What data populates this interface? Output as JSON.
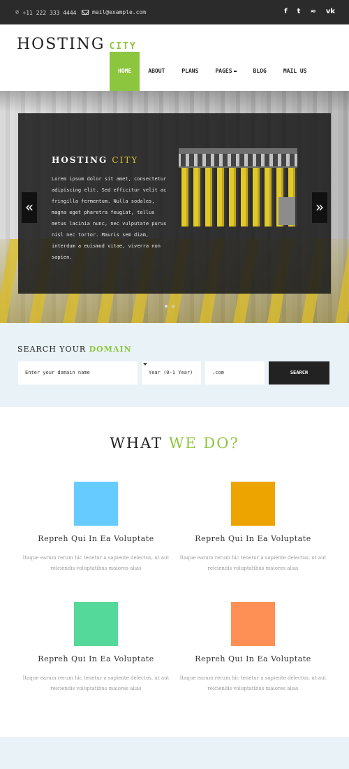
{
  "topbar": {
    "phone": "+11 222 333 4444",
    "email": "mail@example.com",
    "social_icons": [
      "facebook-icon",
      "twitter-icon",
      "rss-icon",
      "vk-icon"
    ],
    "social_glyphs": [
      "f",
      "t",
      "≈",
      "vk"
    ]
  },
  "header": {
    "logo_main": "HOSTING",
    "logo_accent": "CITY",
    "nav": [
      "HOME",
      "ABOUT",
      "PLANS",
      "PAGES",
      "BLOG",
      "MAIL US"
    ],
    "active_nav": "HOME"
  },
  "hero": {
    "title_main": "HOSTING",
    "title_accent": "CITY",
    "text": "Lorem ipsum dolor sit amet, consectetur adipiscing elit. Sed efficitur velit ac fringilla fermentum. Nulla sodales, magna eget pharetra feugiat, tellus metus lacinia nunc, nec vulputate purus nisl nec tortor. Mauris sem diam, interdum a euismod vitae, viverra non sapien.",
    "prev_arrow": "«",
    "next_arrow": "»",
    "slide_count": 2,
    "active_slide": 1
  },
  "search": {
    "title_main": "SEARCH YOUR",
    "title_accent": "DOMAIN",
    "domain_placeholder": "Enter your domain name",
    "year_value": "Year (0-1 Year)",
    "tld_value": ".com",
    "button": "SEARCH"
  },
  "services": {
    "title_main": "WHAT",
    "title_accent": "WE DO?",
    "items": [
      {
        "title": "Repreh Qui In Ea Voluptate",
        "desc": "Itaque earum rerum hic tenetur a sapiente delectus, ut aut reiciendis voluptatibus maiores alias",
        "color": "#66ccff"
      },
      {
        "title": "Repreh Qui In Ea Voluptate",
        "desc": "Itaque earum rerum hic tenetur a sapiente delectus, ut aut reiciendis voluptatibus maiores alias",
        "color": "#eea400"
      },
      {
        "title": "Repreh Qui In Ea Voluptate",
        "desc": "Itaque earum rerum hic tenetur a sapiente delectus, ut aut reiciendis voluptatibus maiores alias",
        "color": "#55d99a"
      },
      {
        "title": "Repreh Qui In Ea Voluptate",
        "desc": "Itaque earum rerum hic tenetur a sapiente delectus, ut aut reiciendis voluptatibus maiores alias",
        "color": "#ff9055"
      }
    ]
  },
  "colors": {
    "accent": "#8cc63e",
    "topbar": "#2b2b2b",
    "search_bg": "#e9f2f6"
  }
}
